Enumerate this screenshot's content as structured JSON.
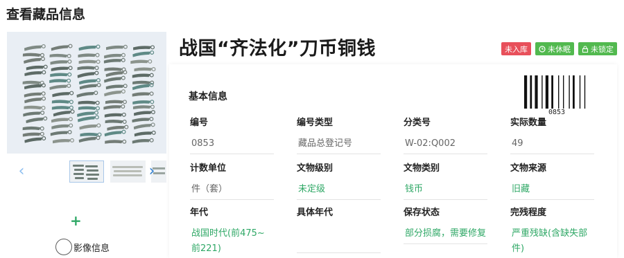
{
  "page": {
    "title": "查看藏品信息"
  },
  "item": {
    "title": "战国“齐法化”刀币铜钱",
    "badges": {
      "storage": "未入库",
      "dormant": "未休眠",
      "lock": "未锁定"
    }
  },
  "media": {
    "prev_icon": "chevron-left-icon",
    "next_icon": "chevron-right-icon",
    "add_icon": "plus-icon",
    "label": "影像信息"
  },
  "basic_info": {
    "title": "基本信息",
    "barcode_number": "0853",
    "fields": [
      {
        "label": "编号",
        "value": "0853"
      },
      {
        "label": "编号类型",
        "value": "藏品总登记号"
      },
      {
        "label": "分类号",
        "value": "W-02:Q002"
      },
      {
        "label": "实际数量",
        "value": "49"
      },
      {
        "label": "计数单位",
        "value": "件（套）"
      },
      {
        "label": "文物级别",
        "value": "未定级"
      },
      {
        "label": "文物类别",
        "value": "钱币"
      },
      {
        "label": "文物来源",
        "value": "旧藏"
      },
      {
        "label": "年代",
        "value": "战国时代(前475~前221)"
      },
      {
        "label": "具体年代",
        "value": ""
      },
      {
        "label": "保存状态",
        "value": "部分损腐，需要修复"
      },
      {
        "label": "完残程度",
        "value": "严重残缺(含缺失部件)"
      }
    ]
  },
  "colors": {
    "accent_green": "#2fa866",
    "badge_red": "#e8505b",
    "badge_green": "#52b94f"
  }
}
